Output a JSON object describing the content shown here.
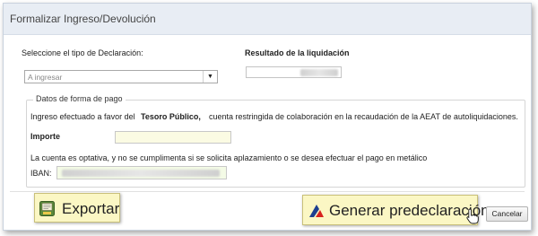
{
  "dialog": {
    "title": "Formalizar Ingreso/Devolución"
  },
  "declaration": {
    "type_label": "Seleccione el tipo de Declaración:",
    "type_value": "A ingresar",
    "result_label": "Resultado de la liquidación"
  },
  "payment": {
    "legend": "Datos de forma de pago",
    "ingreso_prefix": "Ingreso efectuado a favor del",
    "ingreso_bold": "Tesoro Público,",
    "ingreso_suffix": "cuenta restringida de colaboración en la recaudación de la AEAT de autoliquidaciones.",
    "importe_label": "Importe",
    "optional_note": "La cuenta es optativa, y no se cumplimenta si se solicita aplazamiento o se desea efectuar el pago en metálico",
    "iban_label": "IBAN:"
  },
  "buttons": {
    "exportar": "Exportar",
    "generar": "Generar predeclaración",
    "cancelar": "Cancelar"
  },
  "icons": {
    "exportar": "document-export-icon",
    "generar": "aeat-logo-icon",
    "cursor": "hand-pointer-icon"
  },
  "colors": {
    "button_bg": "#fbf7c4",
    "field_bg": "#fbfbe3",
    "titlebar_bg": "#e8edf4"
  }
}
